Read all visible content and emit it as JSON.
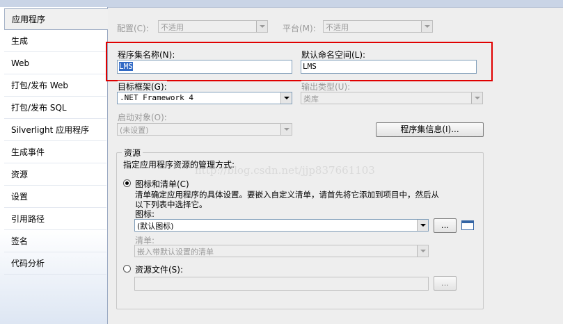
{
  "sidebar": {
    "tabs": [
      {
        "label": "应用程序",
        "selected": true
      },
      {
        "label": "生成"
      },
      {
        "label": "Web"
      },
      {
        "label": "打包/发布 Web"
      },
      {
        "label": "打包/发布 SQL"
      },
      {
        "label": "Silverlight 应用程序"
      },
      {
        "label": "生成事件"
      },
      {
        "label": "资源"
      },
      {
        "label": "设置"
      },
      {
        "label": "引用路径"
      },
      {
        "label": "签名"
      },
      {
        "label": "代码分析"
      }
    ]
  },
  "config": {
    "config_label": "配置(C):",
    "config_value": "不适用",
    "platform_label": "平台(M):",
    "platform_value": "不适用"
  },
  "assembly": {
    "name_label": "程序集名称(N):",
    "name_value": "LMS",
    "namespace_label": "默认命名空间(L):",
    "namespace_value": "LMS"
  },
  "framework": {
    "label": "目标框架(G):",
    "value": ".NET Framework 4"
  },
  "output": {
    "label": "输出类型(U):",
    "value": "类库"
  },
  "startup": {
    "label": "启动对象(O):",
    "value": "(未设置)"
  },
  "assembly_info_button": "程序集信息(I)...",
  "resources": {
    "title": "资源",
    "description": "指定应用程序资源的管理方式:",
    "option_icon_manifest": "图标和清单(C)",
    "option_desc_line1": "清单确定应用程序的具体设置。要嵌入自定义清单，请首先将它添加到项目中，然后从",
    "option_desc_line2": "以下列表中选择它。",
    "icon_label": "图标:",
    "icon_value": "(默认图标)",
    "browse_button": "...",
    "manifest_label": "清单:",
    "manifest_value": "嵌入带默认设置的清单",
    "option_resource_file": "资源文件(S):",
    "resource_file_value": "",
    "browse_button2": "..."
  },
  "watermark": "http://blog.csdn.net/jjp837661103",
  "colors": {
    "highlight_box": "#e00000",
    "selection": "#316ac5"
  }
}
